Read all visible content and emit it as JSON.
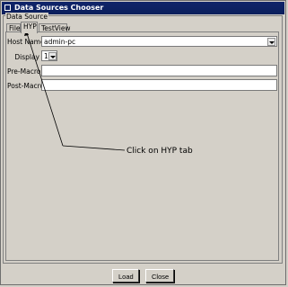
{
  "window": {
    "title": "Data Sources Chooser"
  },
  "group": {
    "label": "Data Source"
  },
  "tabs": [
    {
      "label": "File",
      "active": false
    },
    {
      "label": "HYP",
      "active": true
    },
    {
      "label": "TestView",
      "active": false
    }
  ],
  "form": {
    "host_name": {
      "label": "Host Name",
      "value": "admin-pc"
    },
    "display": {
      "label": "Display",
      "value": "1"
    },
    "pre_macro": {
      "label": "Pre-Macro",
      "value": ""
    },
    "post_macro": {
      "label": "Post-Macro",
      "value": ""
    }
  },
  "annotation": {
    "text": "Click on HYP tab"
  },
  "buttons": {
    "load": "Load",
    "close": "Close"
  },
  "icons": {
    "app": "window-icon",
    "dropdown": "chevron-down-icon"
  }
}
